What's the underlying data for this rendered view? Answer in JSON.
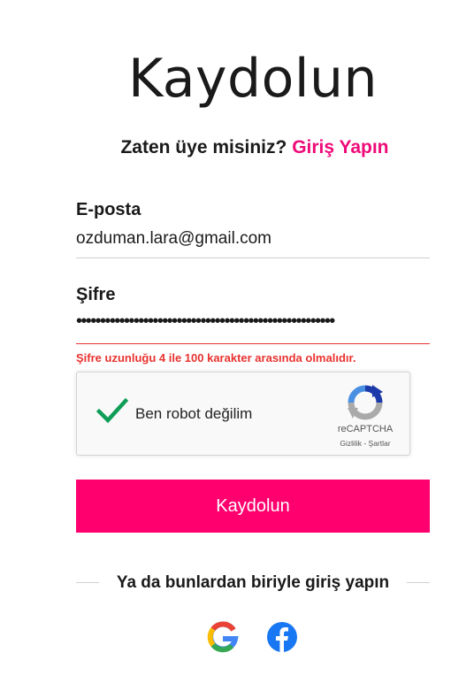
{
  "page": {
    "title": "Kaydolun",
    "subtitle_prefix": "Zaten üye misiniz?",
    "login_link": "Giriş Yapın"
  },
  "form": {
    "email_label": "E-posta",
    "email_value": "ozduman.lara@gmail.com",
    "password_label": "Şifre",
    "password_masked": "••••••••••••••••••••••••••••••••••••••••••••••••••••••",
    "password_error": "Şifre uzunluğu 4 ile 100 karakter arasında olmalıdır.",
    "submit_label": "Kaydolun"
  },
  "captcha": {
    "label": "Ben robot değilim",
    "brand": "reCAPTCHA",
    "links": "Gizlilik - Şartlar"
  },
  "social": {
    "divider_text": "Ya da bunlardan biriyle giriş yapın",
    "providers": [
      "google-icon",
      "facebook-icon"
    ]
  },
  "colors": {
    "accent": "#ee0a78",
    "button": "#ff006e",
    "error": "#e8332f",
    "check": "#0f9d58",
    "facebook": "#1877f2"
  }
}
